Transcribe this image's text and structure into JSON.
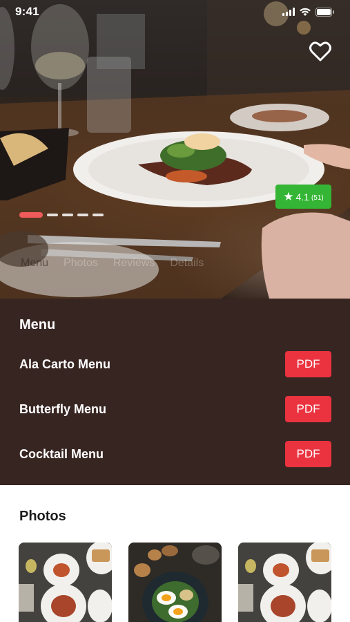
{
  "status_bar": {
    "time": "9:41"
  },
  "hero": {
    "rating": {
      "value": "4.1",
      "count": "(51)"
    },
    "pager": {
      "total": 5,
      "active_index": 0
    },
    "tabs": [
      {
        "label": "Menu",
        "active": true
      },
      {
        "label": "Photos",
        "active": false
      },
      {
        "label": "Reviews",
        "active": false
      },
      {
        "label": "Details",
        "active": false
      }
    ]
  },
  "menu": {
    "title": "Menu",
    "items": [
      {
        "name": "Ala Carto Menu",
        "action": "PDF"
      },
      {
        "name": "Butterfly Menu",
        "action": "PDF"
      },
      {
        "name": "Cocktail Menu",
        "action": "PDF"
      }
    ]
  },
  "photos": {
    "title": "Photos",
    "items": [
      {
        "icon": "food-table-photo"
      },
      {
        "icon": "egg-salad-photo"
      },
      {
        "icon": "food-table-photo"
      }
    ]
  },
  "colors": {
    "menu_background": "#372522",
    "pdf_button": "#eb3340",
    "rating_badge": "#35b535",
    "pager_active": "#ef5b5b"
  },
  "icons": {
    "favorite": "heart-outline-icon",
    "rating": "star-icon",
    "signal": "signal-icon",
    "wifi": "wifi-icon",
    "battery": "battery-icon"
  }
}
